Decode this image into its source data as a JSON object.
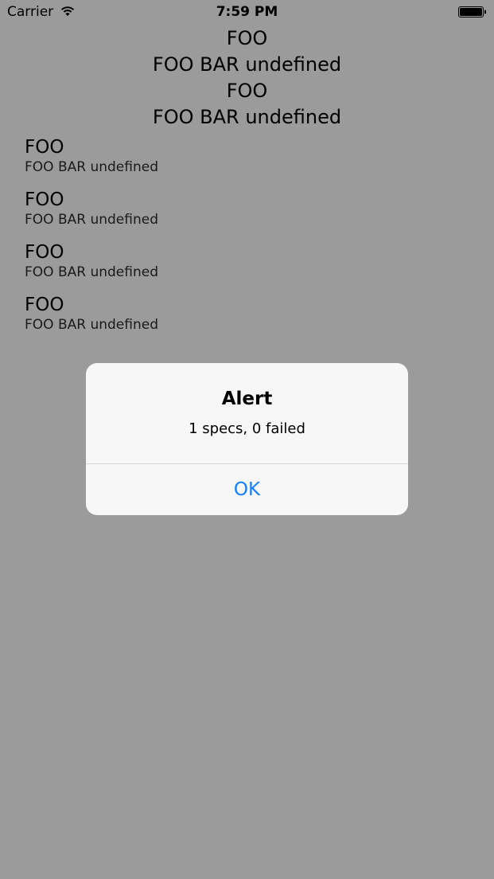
{
  "status_bar": {
    "carrier": "Carrier",
    "time": "7:59 PM",
    "wifi_icon": "wifi-icon",
    "battery_icon": "battery-icon"
  },
  "centered_lines": [
    "FOO",
    "FOO BAR undefined",
    "FOO",
    "FOO BAR undefined"
  ],
  "list": {
    "items": [
      {
        "title": "FOO",
        "subtitle": "FOO BAR undefined"
      },
      {
        "title": "FOO",
        "subtitle": "FOO BAR undefined"
      },
      {
        "title": "FOO",
        "subtitle": "FOO BAR undefined"
      },
      {
        "title": "FOO",
        "subtitle": "FOO BAR undefined"
      }
    ]
  },
  "alert": {
    "title": "Alert",
    "message": "1 specs, 0 failed",
    "ok_label": "OK",
    "button_color": "#157efb"
  },
  "colors": {
    "overlay_background": "#9b9b9b",
    "alert_background": "#f7f7f7"
  }
}
